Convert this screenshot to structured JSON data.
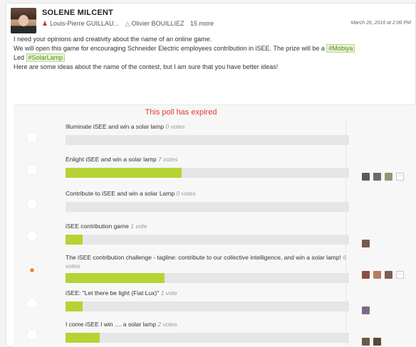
{
  "post": {
    "author": "SOLENE MILCENT",
    "recipient_1": "Louis-Pierre GUILLAU...",
    "recipient_2": "Olivier BOUILLIEZ",
    "more": "15 more",
    "date": "March 26, 2016 at 2:00 PM",
    "line1": "I need your opinions and creativity about the name of an online game.",
    "line2_text": "We will open this game for encouraging Schneider Electric employees contribution in iSEE. The prize will be a",
    "tag1": "#Mobiya",
    "line3_prefix": "Led",
    "tag2": "#SolarLamp",
    "line4": "Here are some ideas about the name of the contest, but I am sure that you have better ideas!"
  },
  "poll": {
    "status": "This poll has expired",
    "options": [
      {
        "label": "Illuminate iSEE and win a solar lamp",
        "votes": "0 votes",
        "pct": 0,
        "selected": false
      },
      {
        "label": "Enlight iSEE and win a solar lamp",
        "votes": "7 votes",
        "pct": 41,
        "selected": false
      },
      {
        "label": "Contribute to iSEE and win a solar Lamp",
        "votes": "0 votes",
        "pct": 0,
        "selected": false
      },
      {
        "label": "iSEE contribution game",
        "votes": "1 vote",
        "pct": 6,
        "selected": false
      },
      {
        "label": "The iSEE contribution challenge - tagline: contribute to our collective intelligence, and win a solar lamp!",
        "votes": "6 votes",
        "pct": 35,
        "selected": true
      },
      {
        "label": "iSEE: \"Let there be light (Fiat Lux)\"",
        "votes": "1 vote",
        "pct": 6,
        "selected": false
      },
      {
        "label": "I come iSEE I win .... a solar lamp",
        "votes": "2 votes",
        "pct": 12,
        "selected": false
      }
    ]
  },
  "icons": {
    "recipient_1": "person-icon",
    "recipient_2": "person-outline-icon"
  },
  "colors": {
    "bar_fill": "#b5d334",
    "expired": "#e53935",
    "selected_radio": "#f08a3c"
  }
}
